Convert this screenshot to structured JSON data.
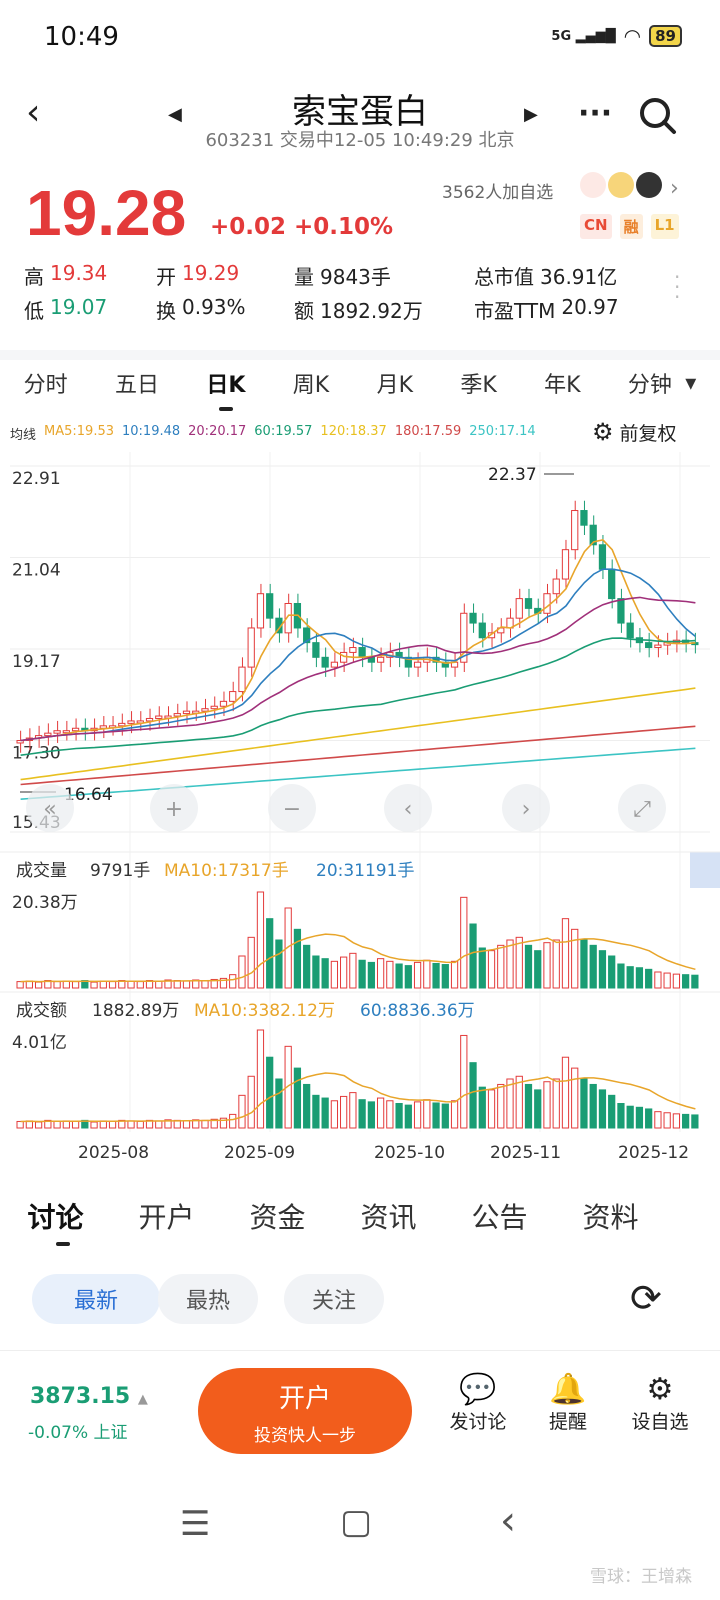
{
  "status_bar": {
    "time": "10:49",
    "network": "5G",
    "battery": "89"
  },
  "header": {
    "stock_name": "索宝蛋白",
    "subtitle": "603231 交易中12-05 10:49:29 北京"
  },
  "quote": {
    "price": "19.28",
    "change": "+0.02 +0.10%",
    "followers": "3562人加自选",
    "badges": [
      {
        "label": "CN",
        "color": "#e84a35",
        "bg": "#fde9e5"
      },
      {
        "label": "融",
        "color": "#e8802a",
        "bg": "#fdeedd"
      },
      {
        "label": "L1",
        "color": "#e8a52a",
        "bg": "#fdf3d8"
      }
    ],
    "row1": [
      {
        "label": "高",
        "value": "19.34",
        "color": "#e33a3a"
      },
      {
        "label": "开",
        "value": "19.29",
        "color": "#e33a3a"
      },
      {
        "label": "量",
        "value": "9843手",
        "color": "#222"
      },
      {
        "label": "总市值",
        "value": "36.91亿",
        "color": "#222"
      }
    ],
    "row2": [
      {
        "label": "低",
        "value": "19.07",
        "color": "#1a9d74"
      },
      {
        "label": "换",
        "value": "0.93%",
        "color": "#222"
      },
      {
        "label": "额",
        "value": "1892.92万",
        "color": "#222"
      },
      {
        "label": "市盈TTM",
        "value": "20.97",
        "color": "#222"
      }
    ]
  },
  "tabs": [
    "分时",
    "五日",
    "日K",
    "周K",
    "月K",
    "季K",
    "年K",
    "分钟"
  ],
  "active_tab": "日K",
  "ma_legend": {
    "label": "均线",
    "items": [
      {
        "text": "MA5:19.53",
        "color": "#e8a52a"
      },
      {
        "text": "10:19.48",
        "color": "#2e7fbf"
      },
      {
        "text": "20:20.17",
        "color": "#a0307a"
      },
      {
        "text": "60:19.57",
        "color": "#1a9d74"
      },
      {
        "text": "120:18.37",
        "color": "#e8c020"
      },
      {
        "text": "180:17.59",
        "color": "#d04a4a"
      },
      {
        "text": "250:17.14",
        "color": "#3cc4c4"
      }
    ],
    "adjust": "前复权"
  },
  "chart_data": {
    "type": "candlestick",
    "price_axis": {
      "ticks": [
        "22.91",
        "21.04",
        "19.17",
        "17.30",
        "15.43"
      ],
      "range": [
        15.43,
        22.91
      ]
    },
    "annotations": {
      "high": "22.37",
      "low": "16.64"
    },
    "x_labels": [
      "2025-08",
      "2025-09",
      "2025-10",
      "2025-11",
      "2025-12"
    ],
    "close_series": [
      17.3,
      17.35,
      17.4,
      17.45,
      17.5,
      17.5,
      17.55,
      17.5,
      17.55,
      17.6,
      17.6,
      17.65,
      17.7,
      17.7,
      17.75,
      17.8,
      17.8,
      17.85,
      17.9,
      17.9,
      17.95,
      18.0,
      18.1,
      18.3,
      18.8,
      19.6,
      20.3,
      19.8,
      19.5,
      20.1,
      19.6,
      19.3,
      19.0,
      18.8,
      18.9,
      19.1,
      19.2,
      19.0,
      18.9,
      19.0,
      19.1,
      19.0,
      18.8,
      18.9,
      19.0,
      18.9,
      18.8,
      18.9,
      19.9,
      19.7,
      19.4,
      19.5,
      19.6,
      19.8,
      20.2,
      20.0,
      19.9,
      20.3,
      20.6,
      21.2,
      22.0,
      21.7,
      21.3,
      20.8,
      20.2,
      19.7,
      19.4,
      19.3,
      19.2,
      19.25,
      19.3,
      19.35,
      19.3,
      19.28
    ],
    "volume_panel": {
      "label": "成交量",
      "current": "9791手",
      "ma10": "MA10:17317手",
      "ma20": "20:31191手",
      "max_tick": "20.38万"
    },
    "amount_panel": {
      "label": "成交额",
      "current": "1882.89万",
      "ma10": "MA10:3382.12万",
      "ma60": "60:8836.36万",
      "max_tick": "4.01亿"
    },
    "volume_values": [
      12,
      13,
      11,
      14,
      12,
      13,
      12,
      14,
      11,
      13,
      12,
      14,
      13,
      12,
      14,
      13,
      15,
      14,
      13,
      15,
      14,
      16,
      18,
      25,
      60,
      95,
      180,
      130,
      90,
      150,
      110,
      80,
      60,
      55,
      50,
      58,
      65,
      52,
      48,
      55,
      50,
      45,
      42,
      48,
      52,
      46,
      44,
      50,
      170,
      120,
      75,
      70,
      80,
      90,
      95,
      80,
      70,
      85,
      90,
      130,
      110,
      90,
      80,
      70,
      60,
      45,
      40,
      38,
      35,
      30,
      28,
      26,
      25,
      24
    ]
  },
  "bottom_tabs": [
    "讨论",
    "开户",
    "资金",
    "资讯",
    "公告",
    "资料"
  ],
  "filters": [
    "最新",
    "最热",
    "关注"
  ],
  "footer": {
    "index_value": "3873.15",
    "index_change": "-0.07% 上证",
    "cta_main": "开户",
    "cta_sub": "投资快人一步",
    "actions": [
      "发讨论",
      "提醒",
      "设自选"
    ]
  },
  "watermark": "雪球：王增森"
}
